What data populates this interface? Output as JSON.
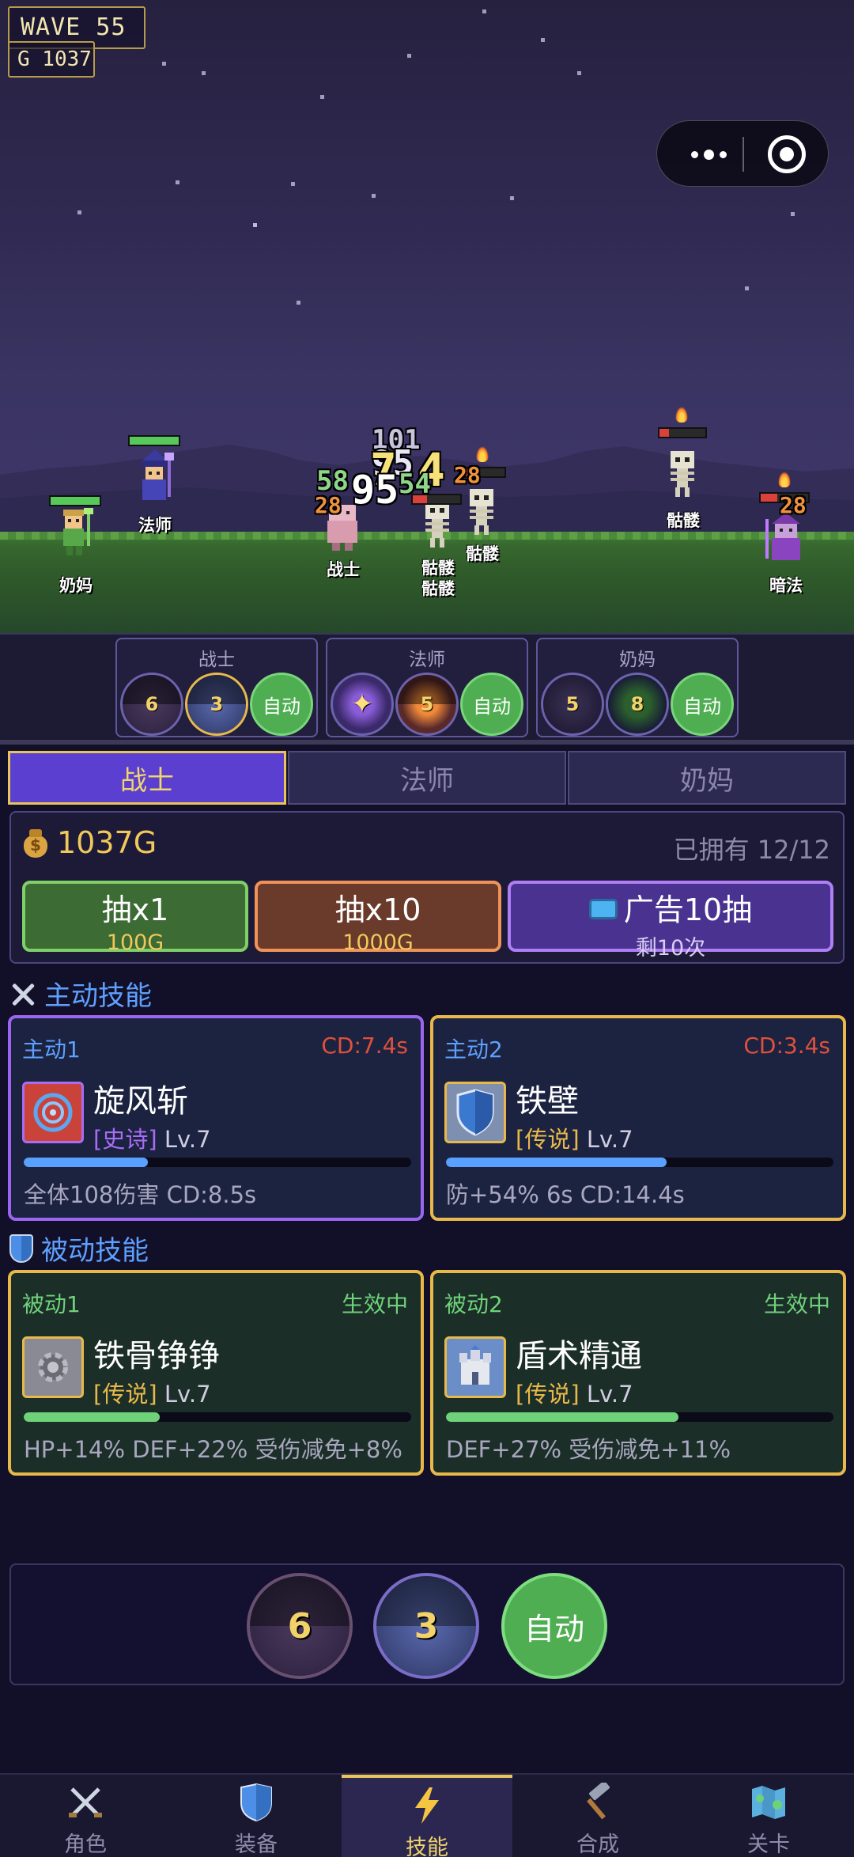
{
  "hud": {
    "wave": "WAVE  55",
    "gold": "G 1037"
  },
  "capsule": {
    "more_icon": "more-dots-icon",
    "close_icon": "target-close-icon"
  },
  "battle": {
    "allies": [
      {
        "name": "奶妈"
      },
      {
        "name": "法师"
      },
      {
        "name": "战士"
      }
    ],
    "enemies": [
      {
        "name": "骷髅"
      },
      {
        "name": "骷髅"
      },
      {
        "name": "骷髅"
      },
      {
        "name": "骷髅"
      },
      {
        "name": "暗法"
      }
    ],
    "damage_numbers": [
      "95",
      "7",
      "4",
      "58",
      "54",
      "28",
      "28",
      "28",
      "95",
      "101"
    ]
  },
  "party": [
    {
      "name": "战士",
      "skills": [
        "6",
        "3"
      ],
      "auto": "自动"
    },
    {
      "name": "法师",
      "skills": [
        "",
        "5"
      ],
      "auto": "自动"
    },
    {
      "name": "奶妈",
      "skills": [
        "5",
        "8"
      ],
      "auto": "自动"
    }
  ],
  "tabs": [
    "战士",
    "法师",
    "奶妈"
  ],
  "shop": {
    "gold": "1037G",
    "owned": "已拥有 12/12",
    "draw1": {
      "label": "抽x1",
      "cost": "100G"
    },
    "draw10": {
      "label": "抽x10",
      "cost": "1000G"
    },
    "draw_ad": {
      "label": "广告10抽",
      "remain": "剩10次"
    }
  },
  "active_title": "主动技能",
  "passive_title": "被动技能",
  "active_skills": [
    {
      "slot": "主动1",
      "cd": "CD:7.4s",
      "name": "旋风斩",
      "rarity": "[史诗]",
      "level": "Lv.7",
      "progress": 0.32,
      "desc": "全体108伤害 CD:8.5s",
      "icon": "whirlwind-icon"
    },
    {
      "slot": "主动2",
      "cd": "CD:3.4s",
      "name": "铁壁",
      "rarity": "[传说]",
      "level": "Lv.7",
      "progress": 0.57,
      "desc": "防+54% 6s CD:14.4s",
      "icon": "shield-icon"
    }
  ],
  "passive_skills": [
    {
      "slot": "被动1",
      "status": "生效中",
      "name": "铁骨铮铮",
      "rarity": "[传说]",
      "level": "Lv.7",
      "progress": 0.35,
      "desc": "HP+14% DEF+22% 受伤减免+8%",
      "icon": "gear-icon"
    },
    {
      "slot": "被动2",
      "status": "生效中",
      "name": "盾术精通",
      "rarity": "[传说]",
      "level": "Lv.7",
      "progress": 0.6,
      "desc": "DEF+27% 受伤减免+11%",
      "icon": "castle-icon"
    }
  ],
  "quick_bar": {
    "skill1": "6",
    "skill2": "3",
    "auto": "自动"
  },
  "nav": [
    {
      "label": "角色",
      "icon": "swords-icon"
    },
    {
      "label": "装备",
      "icon": "shield-icon"
    },
    {
      "label": "技能",
      "icon": "lightning-icon"
    },
    {
      "label": "合成",
      "icon": "hammer-icon"
    },
    {
      "label": "关卡",
      "icon": "map-icon"
    }
  ],
  "colors": {
    "accent": "#5b3fd1",
    "gold": "#f1c85a",
    "epic": "#a86cf5",
    "legend": "#e8b94a",
    "green": "#4fae52"
  }
}
